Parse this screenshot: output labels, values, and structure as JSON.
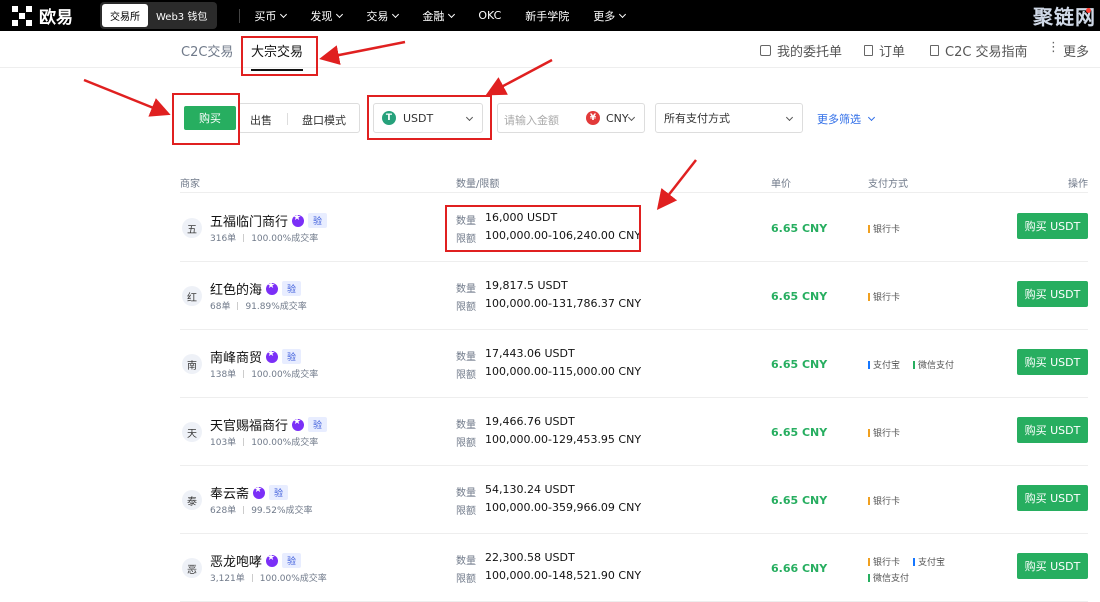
{
  "topnav": {
    "brand": "欧易",
    "segments": [
      "交易所",
      "Web3 钱包"
    ],
    "items": [
      "买币",
      "发现",
      "交易",
      "金融",
      "OKC",
      "新手学院",
      "更多"
    ]
  },
  "subnav": {
    "tabs": [
      "C2C交易",
      "大宗交易"
    ],
    "links": [
      "我的委托单",
      "订单",
      "C2C 交易指南",
      "更多"
    ]
  },
  "filters": {
    "buy": "购买",
    "sell": "出售",
    "book": "盘口模式",
    "crypto": "USDT",
    "amount_placeholder": "请输入金额",
    "fiat": "CNY",
    "payment": "所有支付方式",
    "more": "更多筛选"
  },
  "table": {
    "headers": [
      "商家",
      "数量/限额",
      "单价",
      "支付方式",
      "操作"
    ],
    "qty_label": "数量",
    "limit_label": "限额",
    "button_label": "购买 USDT",
    "rows": [
      {
        "avatar": "五",
        "name": "五福临门商行",
        "verify": "验",
        "orders": "316单",
        "rate": "100.00%成交率",
        "qty": "16,000 USDT",
        "limit": "100,000.00-106,240.00 CNY",
        "price": "6.65 CNY",
        "pay": [
          {
            "label": "银行卡",
            "color": "#f0a020"
          }
        ]
      },
      {
        "avatar": "红",
        "name": "红色的海",
        "verify": "验",
        "orders": "68单",
        "rate": "91.89%成交率",
        "qty": "19,817.5 USDT",
        "limit": "100,000.00-131,786.37 CNY",
        "price": "6.65 CNY",
        "pay": [
          {
            "label": "银行卡",
            "color": "#f0a020"
          }
        ]
      },
      {
        "avatar": "南",
        "name": "南峰商贸",
        "verify": "验",
        "orders": "138单",
        "rate": "100.00%成交率",
        "qty": "17,443.06 USDT",
        "limit": "100,000.00-115,000.00 CNY",
        "price": "6.65 CNY",
        "pay": [
          {
            "label": "支付宝",
            "color": "#1677ff"
          },
          {
            "label": "微信支付",
            "color": "#27ae60"
          }
        ]
      },
      {
        "avatar": "天",
        "name": "天官赐福商行",
        "verify": "验",
        "orders": "103单",
        "rate": "100.00%成交率",
        "qty": "19,466.76 USDT",
        "limit": "100,000.00-129,453.95 CNY",
        "price": "6.65 CNY",
        "pay": [
          {
            "label": "银行卡",
            "color": "#f0a020"
          }
        ]
      },
      {
        "avatar": "泰",
        "name": "奉云斋",
        "verify": "验",
        "orders": "628单",
        "rate": "99.52%成交率",
        "qty": "54,130.24 USDT",
        "limit": "100,000.00-359,966.09 CNY",
        "price": "6.65 CNY",
        "pay": [
          {
            "label": "银行卡",
            "color": "#f0a020"
          }
        ]
      },
      {
        "avatar": "恶",
        "name": "恶龙咆哮",
        "verify": "验",
        "orders": "3,121单",
        "rate": "100.00%成交率",
        "qty": "22,300.58 USDT",
        "limit": "100,000.00-148,521.90 CNY",
        "price": "6.66 CNY",
        "pay": [
          {
            "label": "银行卡",
            "color": "#f0a020"
          },
          {
            "label": "支付宝",
            "color": "#1677ff"
          },
          {
            "label": "微信支付",
            "color": "#27ae60"
          }
        ]
      }
    ]
  },
  "watermark": "聚链网"
}
